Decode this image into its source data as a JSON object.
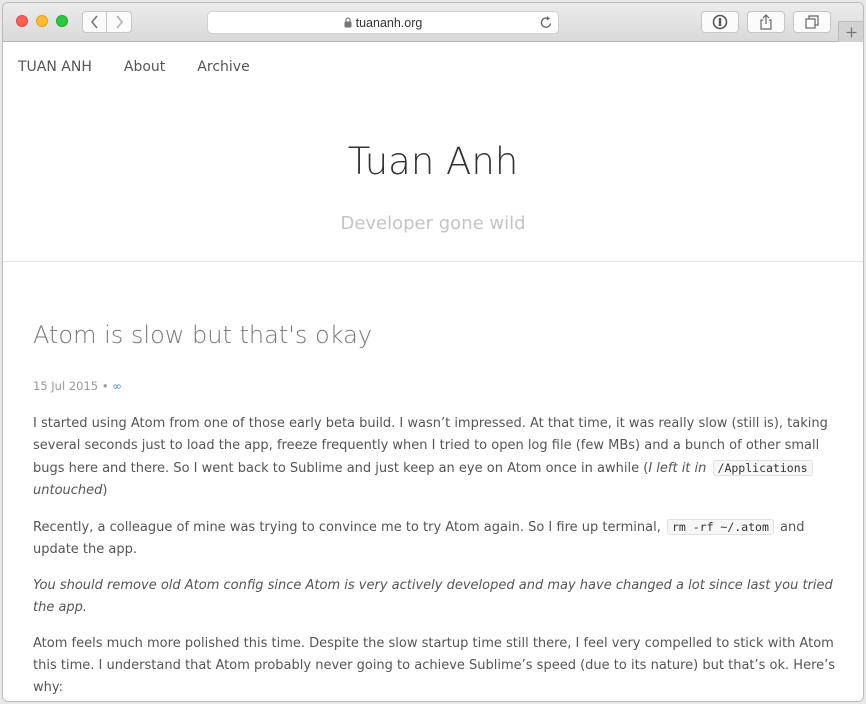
{
  "browser": {
    "url": "tuananh.org"
  },
  "nav": {
    "brand": "TUAN ANH",
    "about": "About",
    "archive": "Archive"
  },
  "header": {
    "title": "Tuan Anh",
    "subtitle": "Developer gone wild"
  },
  "post": {
    "title": "Atom is slow but that's okay",
    "date": "15 Jul 2015",
    "separator": "•",
    "permalink": "∞",
    "p1_text": "I started using Atom from one of those early beta build. I wasn’t impressed. At that time, it was really slow (still is), taking several seconds just to load the app, freeze frequently when I tried to open log file (few MBs) and a bunch of other small bugs here and there. So I went back to Sublime and just keep an eye on Atom once in awhile (",
    "p1_em_start": "I left it in ",
    "p1_code": "/Applications",
    "p1_em_end": " untouched",
    "p1_close": ")",
    "p2_text": "Recently, a colleague of mine was trying to convince me to try Atom again. So I fire up terminal, ",
    "p2_code": "rm -rf ~/.atom",
    "p2_text_end": " and update the app.",
    "p3_em": "You should remove old Atom config since Atom is very actively developed and may have changed a lot since last you tried the app.",
    "p4_text": "Atom feels much more polished this time. Despite the slow startup time still there, I feel very compelled to stick with Atom this time. I understand that Atom probably never going to achieve Sublime’s speed (due to its nature) but that’s ok. Here’s why:"
  },
  "colors": {
    "link": "#4a90c8",
    "text": "#555555",
    "subtitle": "#c4c4c4"
  }
}
